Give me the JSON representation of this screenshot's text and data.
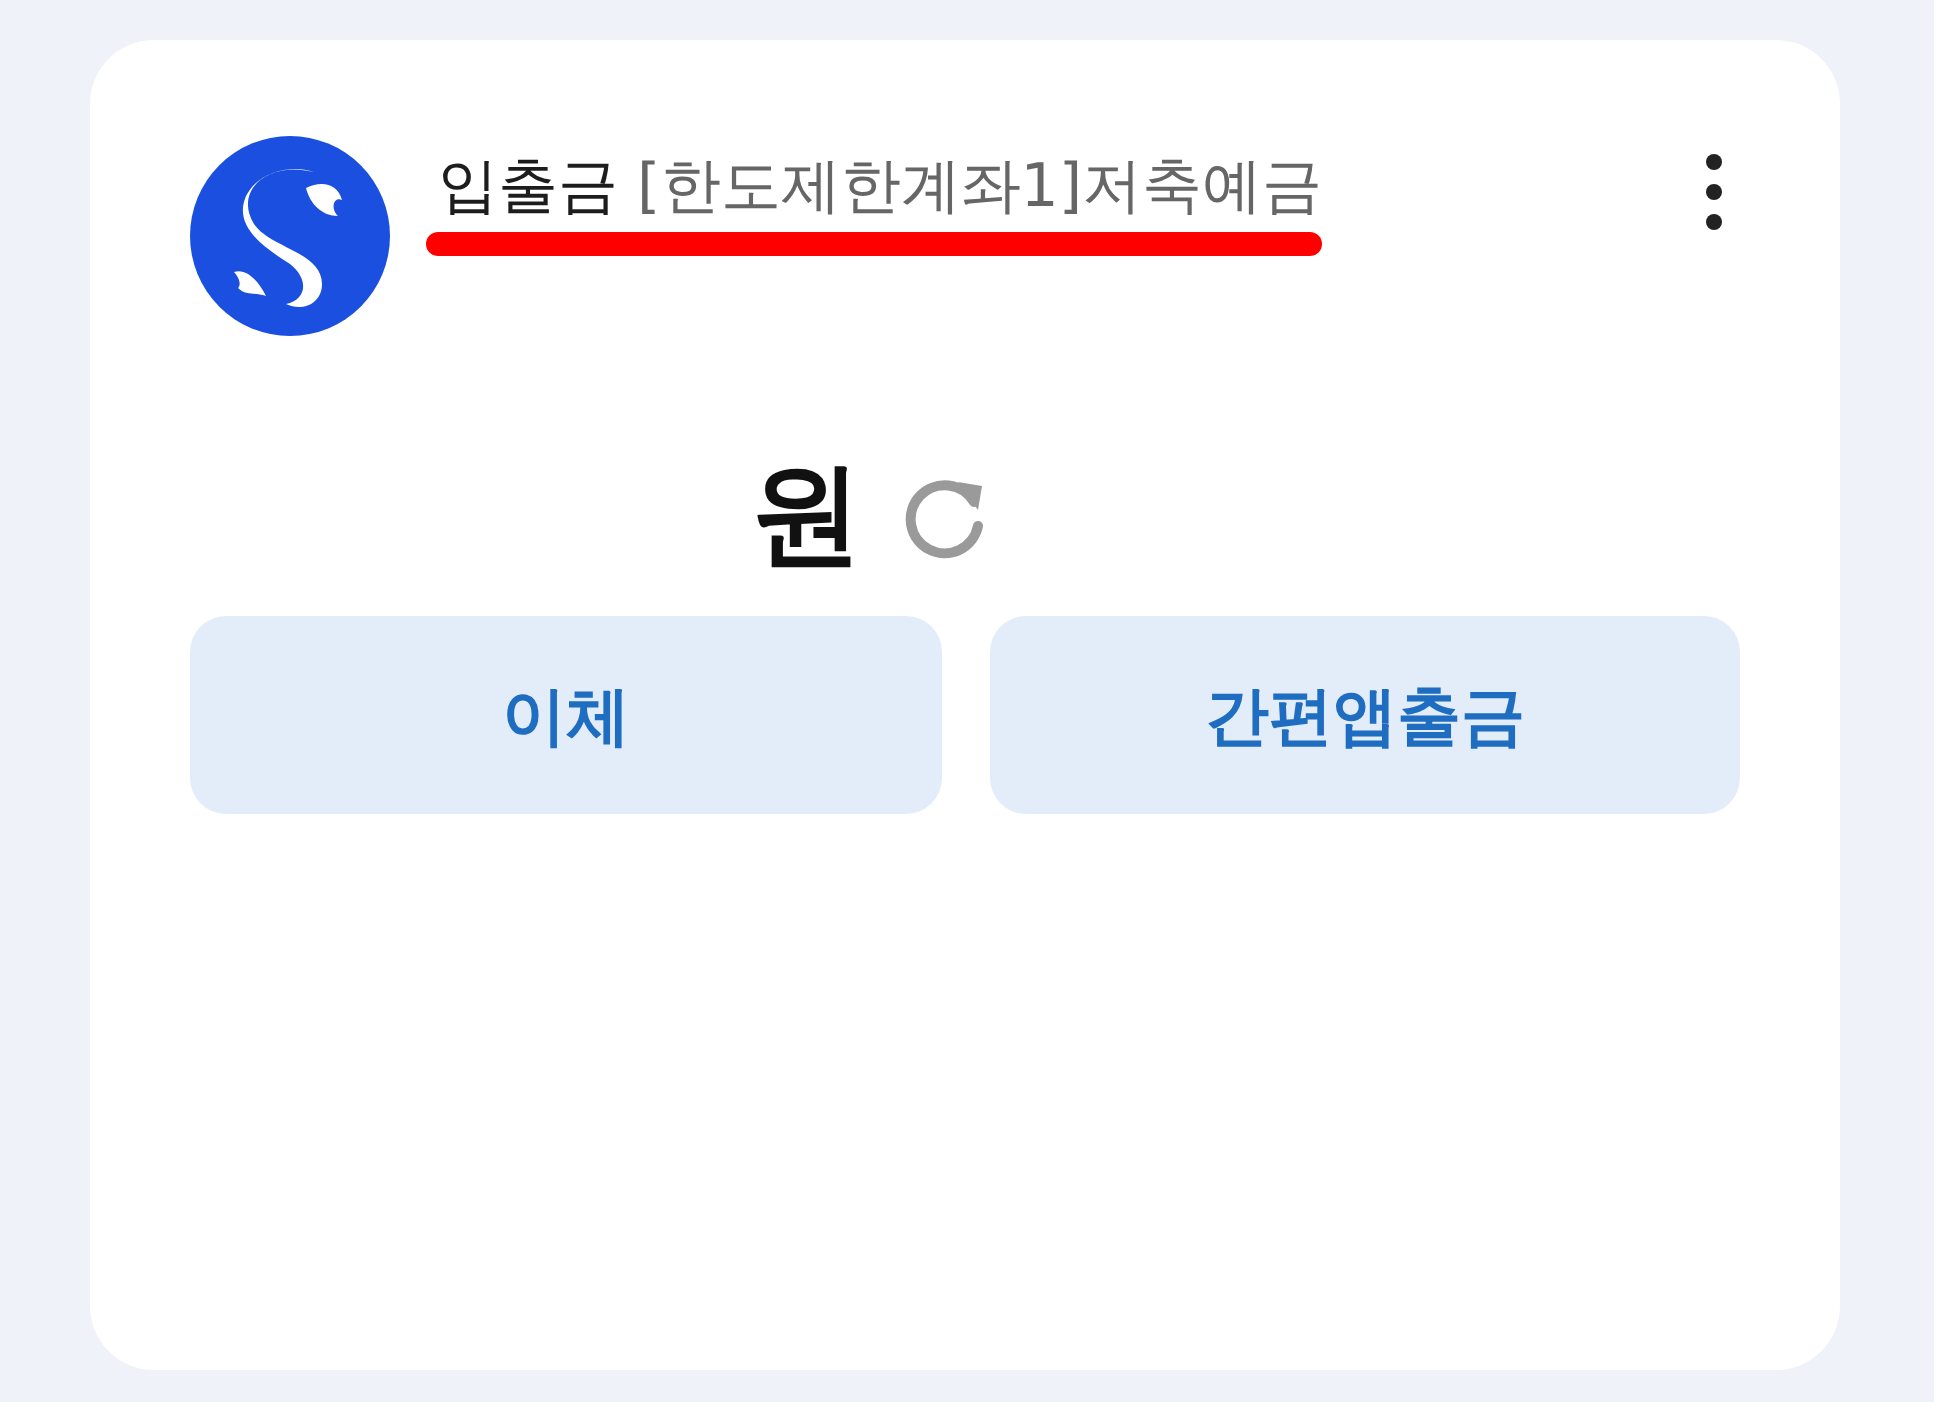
{
  "account": {
    "type": "입출금",
    "name": "[한도제한계좌1]저축예금",
    "annotated": true
  },
  "balance": {
    "unit": "원"
  },
  "buttons": [
    {
      "label": "이체"
    },
    {
      "label": "간편앱출금"
    }
  ]
}
